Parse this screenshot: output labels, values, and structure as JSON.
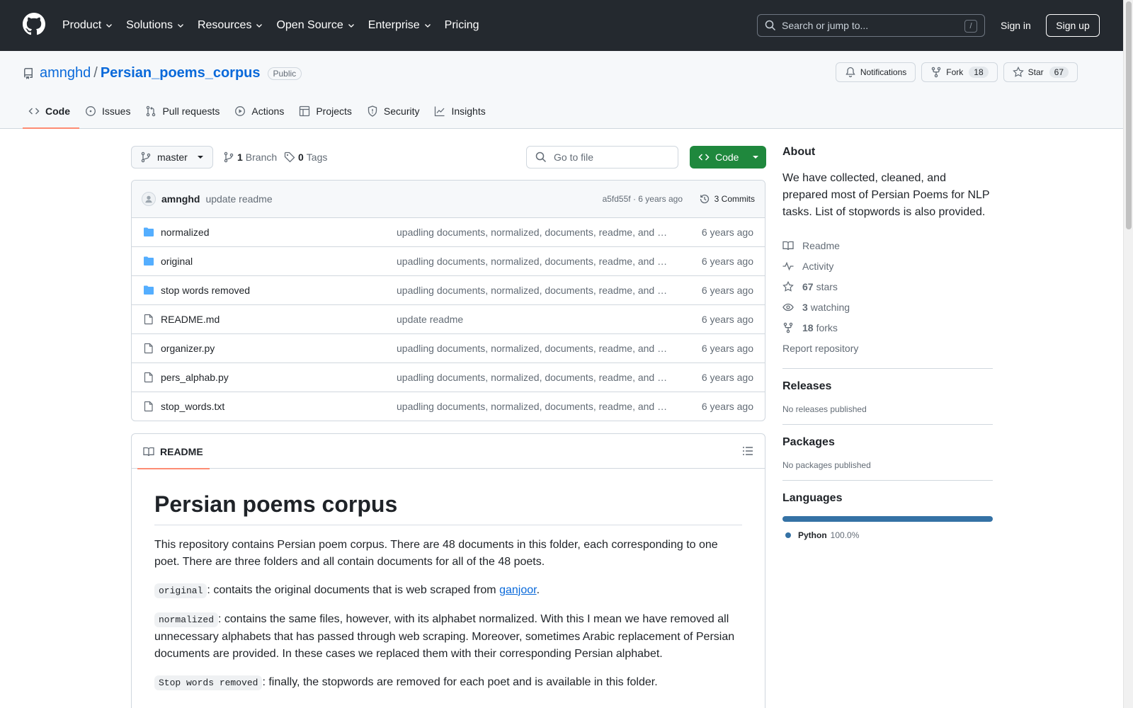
{
  "header": {
    "nav": [
      {
        "label": "Product",
        "dropdown": true
      },
      {
        "label": "Solutions",
        "dropdown": true
      },
      {
        "label": "Resources",
        "dropdown": true
      },
      {
        "label": "Open Source",
        "dropdown": true
      },
      {
        "label": "Enterprise",
        "dropdown": true
      },
      {
        "label": "Pricing",
        "dropdown": false
      }
    ],
    "search_placeholder": "Search or jump to...",
    "search_key": "/",
    "signin": "Sign in",
    "signup": "Sign up"
  },
  "repo": {
    "owner": "amnghd",
    "separator": "/",
    "name": "Persian_poems_corpus",
    "visibility": "Public",
    "notifications_label": "Notifications",
    "fork_label": "Fork",
    "fork_count": "18",
    "star_label": "Star",
    "star_count": "67",
    "tabs": [
      {
        "label": "Code",
        "icon": "code-icon"
      },
      {
        "label": "Issues",
        "icon": "issue-icon"
      },
      {
        "label": "Pull requests",
        "icon": "pull-request-icon"
      },
      {
        "label": "Actions",
        "icon": "play-icon"
      },
      {
        "label": "Projects",
        "icon": "table-icon"
      },
      {
        "label": "Security",
        "icon": "shield-icon"
      },
      {
        "label": "Insights",
        "icon": "graph-icon"
      }
    ]
  },
  "file_nav": {
    "branch": "master",
    "branch_count": "1",
    "branch_label": "Branch",
    "tag_count": "0",
    "tag_label": "Tags",
    "goto_placeholder": "Go to file",
    "code_button": "Code"
  },
  "commit": {
    "author": "amnghd",
    "message": "update readme",
    "meta": "a5fd55f · 6 years ago",
    "commits": "3 Commits"
  },
  "files": [
    {
      "name": "normalized",
      "type": "folder",
      "commit": "upadling documents, normalized, documents, readme, and organizer",
      "age": "6 years ago"
    },
    {
      "name": "original",
      "type": "folder",
      "commit": "upadling documents, normalized, documents, readme, and organizer",
      "age": "6 years ago"
    },
    {
      "name": "stop words removed",
      "type": "folder",
      "commit": "upadling documents, normalized, documents, readme, and organizer",
      "age": "6 years ago"
    },
    {
      "name": "README.md",
      "type": "file",
      "commit": "update readme",
      "age": "6 years ago"
    },
    {
      "name": "organizer.py",
      "type": "file",
      "commit": "upadling documents, normalized, documents, readme, and organizer",
      "age": "6 years ago"
    },
    {
      "name": "pers_alphab.py",
      "type": "file",
      "commit": "upadling documents, normalized, documents, readme, and organizer",
      "age": "6 years ago"
    },
    {
      "name": "stop_words.txt",
      "type": "file",
      "commit": "upadling documents, normalized, documents, readme, and organizer",
      "age": "6 years ago"
    }
  ],
  "readme": {
    "tab_label": "README",
    "title": "Persian poems corpus",
    "intro": "This repository contains Persian poem corpus. There are 48 documents in this folder, each corresponding to one poet. There are three folders and all contain documents for all of the 48 poets.",
    "original_code": "original",
    "original_text": ": contaits the original documents that is web scraped from ",
    "original_link": "ganjoor",
    "original_end": ".",
    "normalized_code": "normalized",
    "normalized_text": ": contains the same files, however, with its alphabet normalized. With this I mean we have removed all unnecessary alphabets that has passed through web scraping. Moreover, sometimes Arabic replacement of Persian documents are provided. In these cases we replaced them with their corresponding Persian alphabet.",
    "stop_code": "Stop words removed",
    "stop_text": ": finally, the stopwords are removed for each poet and is available in this folder."
  },
  "sidebar": {
    "about_title": "About",
    "about_text": "We have collected, cleaned, and prepared most of Persian Poems for NLP tasks. List of stopwords is also provided.",
    "readme": "Readme",
    "activity": "Activity",
    "stars_count": "67",
    "stars_label": "stars",
    "watching_count": "3",
    "watching_label": "watching",
    "forks_count": "18",
    "forks_label": "forks",
    "report": "Report repository",
    "releases_title": "Releases",
    "releases_text": "No releases published",
    "packages_title": "Packages",
    "packages_text": "No packages published",
    "languages_title": "Languages",
    "language_name": "Python",
    "language_pct": "100.0%",
    "language_color": "#3572A5"
  }
}
